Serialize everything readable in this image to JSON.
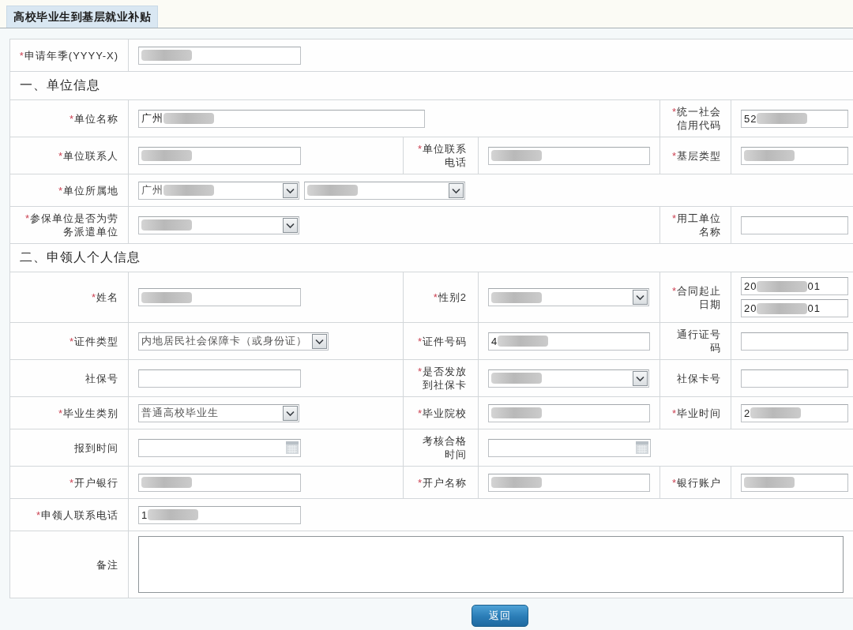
{
  "page_title": "高校毕业生到基层就业补贴",
  "form": {
    "rows": [
      {
        "kind": "fields",
        "left": {
          "mark": "*",
          "label": "申请年季(YYYY-X)",
          "controls": [
            {
              "kind": "text",
              "value": [
                {
                  "kind": "blur"
                }
              ]
            }
          ]
        }
      },
      {
        "kind": "section",
        "title": "一、单位信息"
      },
      {
        "kind": "fields",
        "left": {
          "mark": "*",
          "label": "单位名称",
          "controls": [
            {
              "kind": "text",
              "value": [
                {
                  "kind": "text",
                  "text": "广州"
                },
                {
                  "kind": "blur"
                }
              ]
            }
          ]
        },
        "right": {
          "mark": "*",
          "label": "统一社会信用代码",
          "controls": [
            {
              "kind": "text",
              "value": [
                {
                  "kind": "text",
                  "text": "52"
                },
                {
                  "kind": "blur"
                }
              ]
            }
          ]
        }
      },
      {
        "kind": "fields",
        "left": {
          "mark": "*",
          "label": "单位联系人",
          "controls": [
            {
              "kind": "text",
              "value": [
                {
                  "kind": "blur"
                }
              ]
            }
          ]
        },
        "middle": {
          "mark": "*",
          "label": "单位联系电话",
          "controls": [
            {
              "kind": "text",
              "value": [
                {
                  "kind": "blur"
                }
              ]
            }
          ]
        },
        "right": {
          "mark": "*",
          "label": "基层类型",
          "controls": [
            {
              "kind": "text",
              "value": [
                {
                  "kind": "blur"
                }
              ]
            }
          ]
        }
      },
      {
        "kind": "fields",
        "left": {
          "mark": "*",
          "label": "单位所属地",
          "controls": [
            {
              "kind": "select",
              "value": [
                {
                  "kind": "text",
                  "text": "广州"
                },
                {
                  "kind": "blur"
                }
              ]
            },
            {
              "kind": "select",
              "value": [
                {
                  "kind": "blur"
                }
              ]
            }
          ]
        }
      },
      {
        "kind": "fields",
        "left": {
          "mark": "*",
          "label": "参保单位是否为劳务派遣单位",
          "controls": [
            {
              "kind": "select",
              "value": [
                {
                  "kind": "blur"
                }
              ]
            }
          ]
        },
        "right": {
          "mark": "*",
          "label": "用工单位名称",
          "controls": [
            {
              "kind": "text"
            }
          ]
        }
      },
      {
        "kind": "section",
        "title": "二、申领人个人信息"
      },
      {
        "kind": "fields",
        "left": {
          "mark": "*",
          "label": "姓名",
          "controls": [
            {
              "kind": "text",
              "value": [
                {
                  "kind": "blur"
                }
              ]
            }
          ]
        },
        "middle": {
          "mark": "*",
          "label": "性别2",
          "controls": [
            {
              "kind": "select",
              "value": [
                {
                  "kind": "blur"
                }
              ]
            }
          ]
        },
        "right": {
          "mark": "*",
          "label": "合同起止日期",
          "controls": [
            {
              "kind": "text",
              "value": [
                {
                  "kind": "text",
                  "text": "20"
                },
                {
                  "kind": "blur"
                },
                {
                  "kind": "text",
                  "text": "01"
                }
              ]
            },
            {
              "kind": "text",
              "value": [
                {
                  "kind": "text",
                  "text": "20"
                },
                {
                  "kind": "blur"
                },
                {
                  "kind": "text",
                  "text": "01"
                }
              ]
            }
          ]
        }
      },
      {
        "kind": "fields",
        "left": {
          "mark": "*",
          "label": "证件类型",
          "controls": [
            {
              "kind": "select",
              "value": [
                {
                  "kind": "text",
                  "text": "内地居民社会保障卡（或身份证）"
                }
              ]
            }
          ]
        },
        "middle": {
          "mark": "*",
          "label": "证件号码",
          "controls": [
            {
              "kind": "text",
              "value": [
                {
                  "kind": "text",
                  "text": "4"
                },
                {
                  "kind": "blur"
                }
              ]
            }
          ]
        },
        "right": {
          "label": "通行证号码",
          "controls": [
            {
              "kind": "text"
            }
          ]
        }
      },
      {
        "kind": "fields",
        "left": {
          "label": "社保号",
          "controls": [
            {
              "kind": "text"
            }
          ]
        },
        "middle": {
          "mark": "*",
          "label": "是否发放到社保卡",
          "controls": [
            {
              "kind": "select",
              "value": [
                {
                  "kind": "blur"
                }
              ]
            }
          ]
        },
        "right": {
          "label": "社保卡号",
          "controls": [
            {
              "kind": "text"
            }
          ]
        }
      },
      {
        "kind": "fields",
        "left": {
          "mark": "*",
          "label": "毕业生类别",
          "controls": [
            {
              "kind": "select",
              "value": [
                {
                  "kind": "text",
                  "text": "普通高校毕业生"
                }
              ]
            }
          ]
        },
        "middle": {
          "mark": "*",
          "label": "毕业院校",
          "controls": [
            {
              "kind": "text",
              "value": [
                {
                  "kind": "blur"
                }
              ]
            }
          ]
        },
        "right": {
          "mark": "*",
          "label": "毕业时间",
          "controls": [
            {
              "kind": "text",
              "value": [
                {
                  "kind": "text",
                  "text": "2"
                },
                {
                  "kind": "blur"
                }
              ]
            }
          ]
        }
      },
      {
        "kind": "fields",
        "left": {
          "label": "报到时间",
          "controls": [
            {
              "kind": "date"
            }
          ]
        },
        "middle": {
          "label": "考核合格时间",
          "controls": [
            {
              "kind": "date"
            }
          ]
        }
      },
      {
        "kind": "fields",
        "left": {
          "mark": "*",
          "label": "开户银行",
          "controls": [
            {
              "kind": "text",
              "value": [
                {
                  "kind": "blur"
                }
              ]
            }
          ]
        },
        "middle": {
          "mark": "*",
          "label": "开户名称",
          "controls": [
            {
              "kind": "text",
              "value": [
                {
                  "kind": "blur"
                }
              ]
            }
          ]
        },
        "right": {
          "mark": "*",
          "label": "银行账户",
          "controls": [
            {
              "kind": "text",
              "value": [
                {
                  "kind": "blur"
                }
              ]
            }
          ]
        }
      },
      {
        "kind": "fields",
        "left": {
          "mark": "*",
          "label": "申领人联系电话",
          "controls": [
            {
              "kind": "text",
              "value": [
                {
                  "kind": "text",
                  "text": "1"
                },
                {
                  "kind": "blur"
                }
              ]
            }
          ]
        }
      },
      {
        "kind": "fields",
        "left": {
          "label": "备注",
          "controls": [
            {
              "kind": "textarea"
            }
          ]
        }
      }
    ]
  },
  "buttons": [
    {
      "label": "返回"
    }
  ]
}
